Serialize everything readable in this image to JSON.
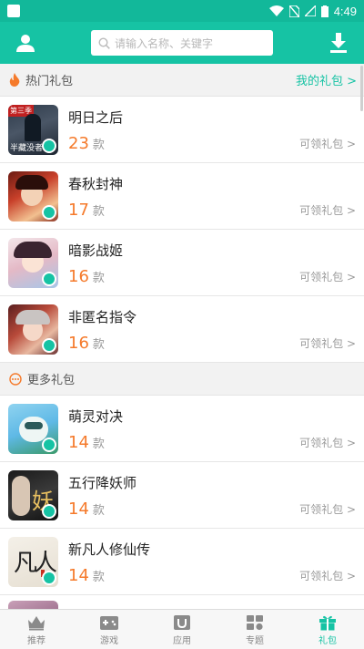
{
  "status_bar": {
    "time": "4:49"
  },
  "app_bar": {
    "search_placeholder": "请输入名称、关键字"
  },
  "sections": {
    "hot": {
      "title": "热门礼包",
      "link": "我的礼包 >"
    },
    "more": {
      "title": "更多礼包"
    }
  },
  "hot_items": [
    {
      "name": "明日之后",
      "count": "23",
      "unit": "款",
      "action": "可领礼包 >"
    },
    {
      "name": "春秋封神",
      "count": "17",
      "unit": "款",
      "action": "可领礼包 >"
    },
    {
      "name": "暗影战姬",
      "count": "16",
      "unit": "款",
      "action": "可领礼包 >"
    },
    {
      "name": "非匿名指令",
      "count": "16",
      "unit": "款",
      "action": "可领礼包 >"
    }
  ],
  "more_items": [
    {
      "name": "萌灵对决",
      "count": "14",
      "unit": "款",
      "action": "可领礼包 >"
    },
    {
      "name": "五行降妖师",
      "count": "14",
      "unit": "款",
      "action": "可领礼包 >"
    },
    {
      "name": "新凡人修仙传",
      "count": "14",
      "unit": "款",
      "action": "可领礼包 >"
    }
  ],
  "thumb_labels": {
    "first_game_art_text": "半藏没者",
    "first_game_tag": "第三季",
    "wuxing_art": "妖",
    "fanren_art": "凡人"
  },
  "tabs": [
    {
      "label": "推荐",
      "icon": "crown-icon"
    },
    {
      "label": "游戏",
      "icon": "gamepad-icon"
    },
    {
      "label": "应用",
      "icon": "magnet-icon"
    },
    {
      "label": "专题",
      "icon": "grid-icon"
    },
    {
      "label": "礼包",
      "icon": "gift-icon",
      "active": true
    }
  ],
  "colors": {
    "accent": "#16c3a4",
    "count": "#f57a2b"
  }
}
